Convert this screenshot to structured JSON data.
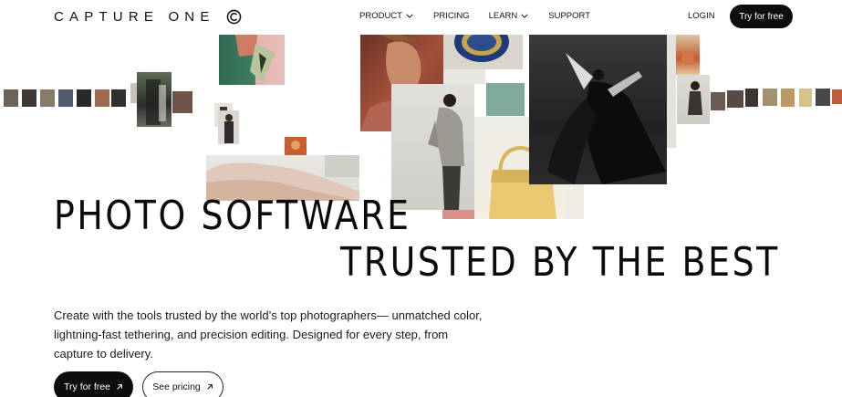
{
  "brand": {
    "name": "CAPTURE ONE",
    "logo_icon": "capture-one-mark-icon"
  },
  "nav": {
    "items": [
      {
        "label": "PRODUCT",
        "has_dropdown": true
      },
      {
        "label": "PRICING",
        "has_dropdown": false
      },
      {
        "label": "LEARN",
        "has_dropdown": true
      },
      {
        "label": "SUPPORT",
        "has_dropdown": false
      }
    ],
    "login_label": "LOGIN",
    "cta_label": "Try for free"
  },
  "hero": {
    "headline_line1": "PHOTO SOFTWARE",
    "headline_line2": "TRUSTED BY THE BEST",
    "description": "Create with the tools trusted by the world’s top photographers— unmatched color, lightning-fast tethering, and precision editing. Designed for every step, from capture to delivery.",
    "primary_cta": "Try for free",
    "secondary_cta": "See pricing"
  },
  "colors": {
    "text": "#111111",
    "button_dark": "#0d0d0d",
    "background": "#ffffff"
  }
}
